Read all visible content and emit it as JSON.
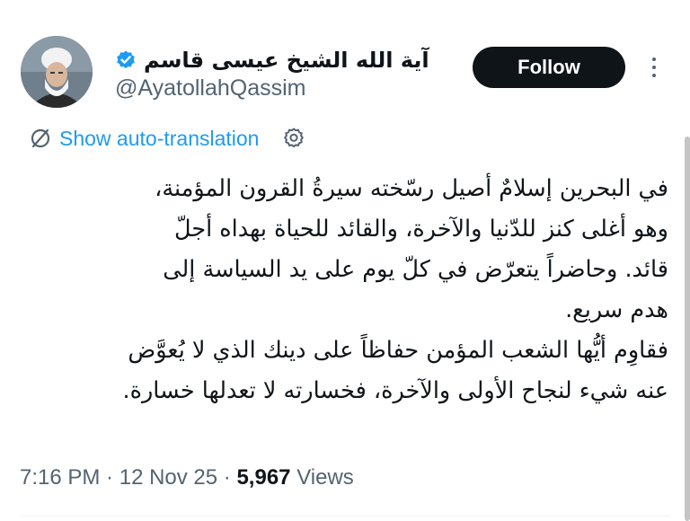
{
  "author": {
    "display_name": "آية الله الشيخ عيسى قاسم",
    "handle": "@AyatollahQassim",
    "verified": true
  },
  "actions": {
    "follow_label": "Follow",
    "more_icon": "more-vertical-icon"
  },
  "translation": {
    "label": "Show auto-translation",
    "icon": "translate-icon",
    "settings_icon": "gear-icon"
  },
  "tweet": {
    "lines": [
      "في البحرين إسلامٌ أصيل رسّخته سيرةُ القرون المؤمنة،",
      "وهو أغلى كنز للدّنيا والآخرة، والقائد للحياة بهداه أجلّ",
      "قائد. وحاضراً يتعرّض في كلّ يوم على يد السياسة إلى",
      "هدم سريع.",
      "فقاوِم أيُّها الشعب المؤمن حفاظاً على دينك الذي لا يُعوَّض",
      "عنه شيء لنجاح الأولى والآخرة، فخسارته لا تعدلها خسارة."
    ]
  },
  "meta": {
    "time": "7:16 PM",
    "separator": " · ",
    "date": "12 Nov 25",
    "views_count": "5,967",
    "views_label": "Views"
  },
  "colors": {
    "accent": "#1d9bf0",
    "text": "#0f1419",
    "secondary": "#536471",
    "button_bg": "#0f1419"
  }
}
